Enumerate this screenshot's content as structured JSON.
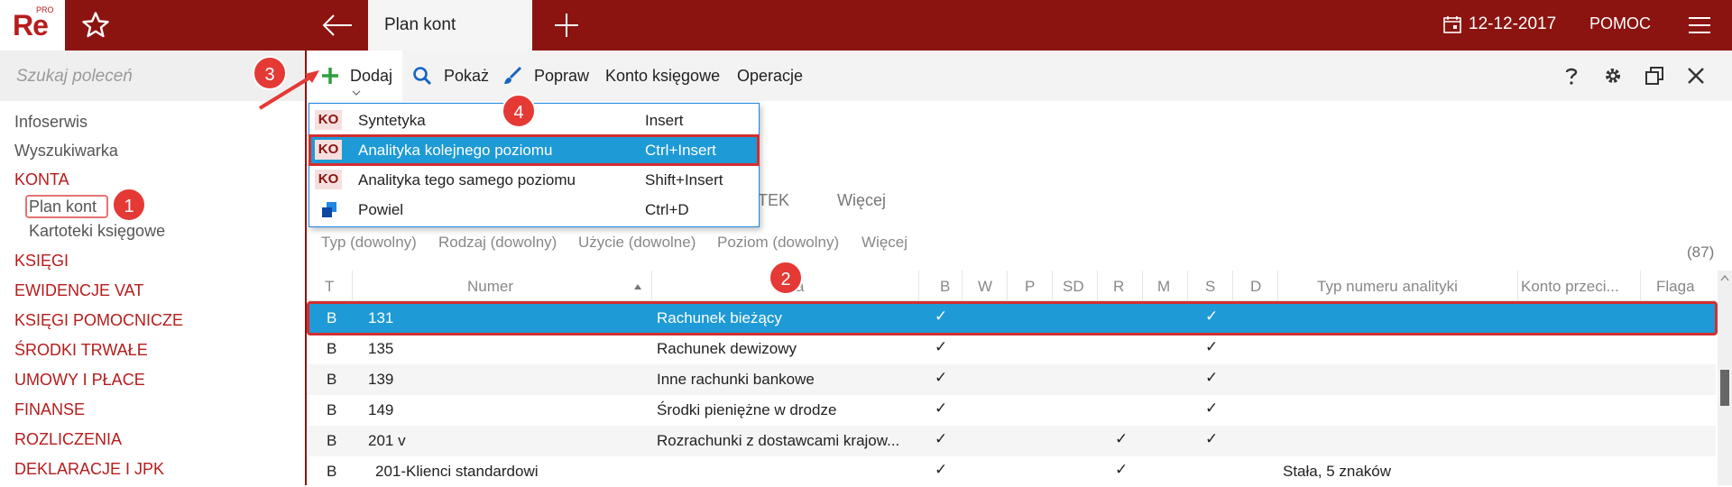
{
  "app": {
    "logo": "Re",
    "logo_sup": "PRO",
    "tab_title": "Plan kont",
    "date": "12-12-2017",
    "help": "POMOC"
  },
  "sidebar": {
    "search_placeholder": "Szukaj poleceń",
    "items": [
      {
        "label": "Infoserwis"
      },
      {
        "label": "Wyszukiwarka"
      },
      {
        "label": "KONTA"
      },
      {
        "label": "Plan kont"
      },
      {
        "label": "Kartoteki księgowe"
      },
      {
        "label": "KSIĘGI"
      },
      {
        "label": "EWIDENCJE VAT"
      },
      {
        "label": "KSIĘGI POMOCNICZE"
      },
      {
        "label": "ŚRODKI TRWAŁE"
      },
      {
        "label": "UMOWY I PŁACE"
      },
      {
        "label": "FINANSE"
      },
      {
        "label": "ROZLICZENIA"
      },
      {
        "label": "DEKLARACJE I JPK"
      }
    ]
  },
  "toolbar": {
    "dodaj": "Dodaj",
    "pokaz": "Pokaż",
    "popraw": "Popraw",
    "konto": "Konto księgowe",
    "operacje": "Operacje"
  },
  "dropdown": {
    "items": [
      {
        "badge": "KO",
        "label": "Syntetyka",
        "shortcut": "Insert"
      },
      {
        "badge": "KO",
        "label": "Analityka kolejnego poziomu",
        "shortcut": "Ctrl+Insert"
      },
      {
        "badge": "KO",
        "label": "Analityka tego samego poziomu",
        "shortcut": "Shift+Insert"
      },
      {
        "badge": "",
        "label": "Powiel",
        "shortcut": "Ctrl+D"
      }
    ]
  },
  "tabs2": {
    "tab_partial": "TEK",
    "more": "Więcej"
  },
  "filters": {
    "typ": "Typ (dowolny)",
    "rodzaj": "Rodzaj (dowolny)",
    "uzycie": "Użycie (dowolne)",
    "poziom": "Poziom (dowolny)",
    "wiecej": "Więcej",
    "count": "(87)"
  },
  "table": {
    "columns": {
      "t": "T",
      "numer": "Numer",
      "nazwa_partial": "Na",
      "nazwa_end": "a",
      "b": "B",
      "w": "W",
      "p": "P",
      "sd": "SD",
      "r": "R",
      "m": "M",
      "s": "S",
      "d": "D",
      "typ_numeru": "Typ numeru analityki",
      "konto_przeci": "Konto przeci...",
      "flaga": "Flaga"
    },
    "rows": [
      {
        "t": "B",
        "numer": "131",
        "nazwa": "Rachunek bieżący",
        "b": "✓",
        "r": "",
        "s": "✓",
        "typ": ""
      },
      {
        "t": "B",
        "numer": "135",
        "nazwa": "Rachunek dewizowy",
        "b": "✓",
        "r": "",
        "s": "✓",
        "typ": ""
      },
      {
        "t": "B",
        "numer": "139",
        "nazwa": "Inne rachunki bankowe",
        "b": "✓",
        "r": "",
        "s": "✓",
        "typ": ""
      },
      {
        "t": "B",
        "numer": "149",
        "nazwa": "Środki pieniężne w drodze",
        "b": "✓",
        "r": "",
        "s": "✓",
        "typ": ""
      },
      {
        "t": "B",
        "numer": "201 v",
        "nazwa": "Rozrachunki z dostawcami krajow...",
        "b": "✓",
        "r": "✓",
        "s": "✓",
        "typ": ""
      },
      {
        "t": "B",
        "numer": "201-Klienci standardowi",
        "nazwa": "",
        "b": "✓",
        "r": "✓",
        "s": "",
        "typ": "Stała, 5 znaków"
      }
    ]
  },
  "callouts": [
    "1",
    "2",
    "3",
    "4"
  ],
  "colors": {
    "brand": "#8b1410",
    "selection": "#1e9ad6",
    "callout": "#e53935"
  }
}
